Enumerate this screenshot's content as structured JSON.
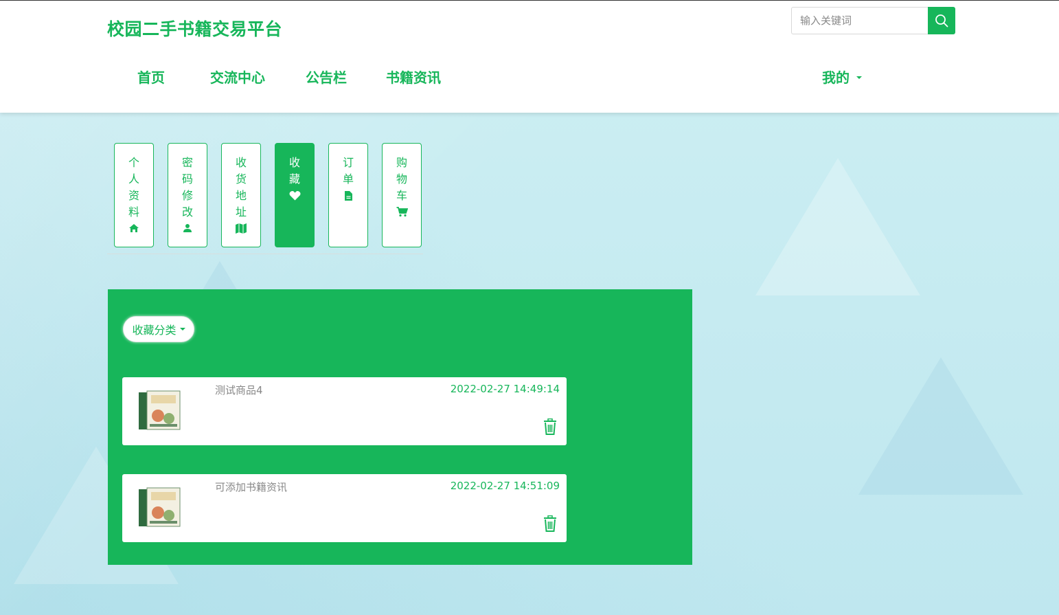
{
  "site": {
    "title": "校园二手书籍交易平台"
  },
  "search": {
    "placeholder": "输入关键词"
  },
  "nav": {
    "items": [
      "首页",
      "交流中心",
      "公告栏",
      "书籍资讯"
    ],
    "mine": "我的"
  },
  "tabs": [
    {
      "chars": [
        "个",
        "人",
        "资",
        "料"
      ],
      "icon": "home-icon"
    },
    {
      "chars": [
        "密",
        "码",
        "修",
        "改"
      ],
      "icon": "user-icon"
    },
    {
      "chars": [
        "收",
        "货",
        "地",
        "址"
      ],
      "icon": "map-icon"
    },
    {
      "chars": [
        "收",
        "藏"
      ],
      "icon": "heart-icon",
      "active": true
    },
    {
      "chars": [
        "订",
        "单"
      ],
      "icon": "file-icon"
    },
    {
      "chars": [
        "购",
        "物",
        "车"
      ],
      "icon": "cart-icon"
    }
  ],
  "favorites": {
    "category_label": "收藏分类",
    "items": [
      {
        "name": "测试商品4",
        "time": "2022-02-27 14:49:14"
      },
      {
        "name": "可添加书籍资讯",
        "time": "2022-02-27 14:51:09"
      }
    ]
  },
  "colors": {
    "accent": "#17b65a",
    "background": "#c7eef2"
  }
}
